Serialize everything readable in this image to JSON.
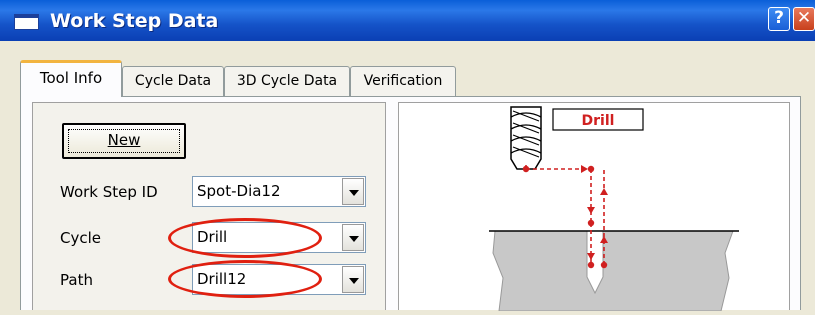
{
  "window": {
    "title": "Work Step Data",
    "icon": "window-icon",
    "help_label": "?",
    "close_label": "✕"
  },
  "tabs": [
    {
      "label": "Tool Info",
      "active": true
    },
    {
      "label": "Cycle Data",
      "active": false
    },
    {
      "label": "3D Cycle Data",
      "active": false
    },
    {
      "label": "Verification",
      "active": false
    }
  ],
  "tool_info": {
    "new_button": "New",
    "fields": [
      {
        "label": "Work Step ID",
        "value": "Spot-Dia12",
        "highlighted": false
      },
      {
        "label": "Cycle",
        "value": "Drill",
        "highlighted": true
      },
      {
        "label": "Path",
        "value": "Drill12",
        "highlighted": true
      }
    ]
  },
  "diagram": {
    "tag": "Drill",
    "icon": "drill-bit-icon"
  },
  "colors": {
    "titlebar": "#0a5fd8",
    "highlight": "#e02010",
    "path": "#d02020",
    "workpiece": "#c8c8c8"
  }
}
